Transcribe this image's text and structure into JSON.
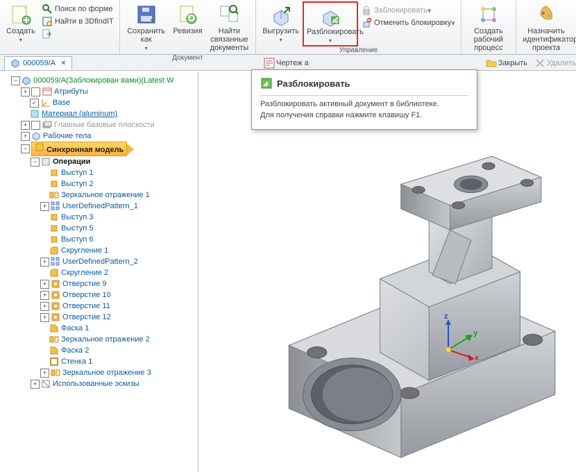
{
  "ribbon": {
    "groups": {
      "document": "Документ",
      "manage": "Управление"
    },
    "create": "Создать",
    "search_form": "Поиск по форме",
    "find_3dfindit": "Найти в 3DfindIT",
    "save_as": "Сохранить как",
    "revision": "Ревизия",
    "find_linked": "Найти связанные документы",
    "upload": "Выгрузить",
    "unlock": "Разблокировать",
    "lock": "Заблокировать",
    "cancel_lock": "Отменить блокировку",
    "create_wf": "Создать рабочий процесс",
    "assign_id": "Назначить идентификатор проекта"
  },
  "toolbar2": {
    "drawing": "Чертеж а",
    "close": "Закрыть",
    "delete": "Удалить"
  },
  "tab": {
    "label": "000059/A",
    "close": "×"
  },
  "tree": {
    "root": "000059/A(Заблокирован вами)(Latest W",
    "attrs": "Атрибуты",
    "base": "Base",
    "material": "Материал (aluminum)",
    "main_planes": "Главные базовые плоскости",
    "bodies": "Рабочие тела",
    "sync_model": "Синхронная модель",
    "operations": "Операции",
    "items": {
      "v1": "Выступ 1",
      "v2": "Выступ 2",
      "mirr1": "Зеркальное отражение 1",
      "udp1": "UserDefinedPattern_1",
      "v3": "Выступ 3",
      "v5": "Выступ 5",
      "v6": "Выступ 6",
      "r1": "Скругление 1",
      "udp2": "UserDefinedPattern_2",
      "r2": "Скругление 2",
      "h9": "Отверстие 9",
      "h10": "Отверстие 10",
      "h11": "Отверстие 11",
      "h12": "Отверстие 12",
      "ch1": "Фаска 1",
      "mirr2": "Зеркальное отражение 2",
      "ch2": "Фаска 2",
      "wall1": "Стенка 1",
      "mirr3": "Зеркальное отражение 3"
    },
    "used_sketches": "Использованные эскизы"
  },
  "tooltip": {
    "title": "Разблокировать",
    "line1": "Разблокировать активный документ в библиотеке.",
    "line2": "Для получения справки нажмите клавишу F1."
  },
  "icons": {
    "plus": "+",
    "minus": "−",
    "check": "✓"
  },
  "axis": {
    "x": "x",
    "y": "y",
    "z": "z"
  }
}
